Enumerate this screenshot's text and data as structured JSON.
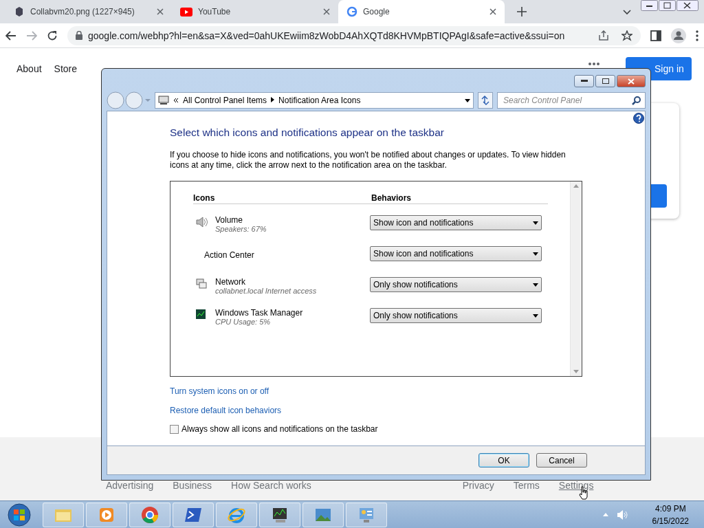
{
  "browser": {
    "tabs": [
      {
        "title": "Collabvm20.png (1227×945)",
        "kind": "image",
        "selected": false
      },
      {
        "title": "YouTube",
        "kind": "youtube",
        "selected": false
      },
      {
        "title": "Google",
        "kind": "google",
        "selected": true
      }
    ],
    "address": "google.com/webhp?hl=en&sa=X&ved=0ahUKEwiim8zWobD4AhXQTd8KHVMpBTIQPAgI&safe=active&ssui=on"
  },
  "page": {
    "left_links": [
      "About",
      "Store"
    ],
    "sign_in": "Sign in",
    "footer_left": [
      "Advertising",
      "Business",
      "How Search works"
    ],
    "footer_right": [
      "Privacy",
      "Terms",
      "Settings"
    ]
  },
  "dialog": {
    "breadcrumb": [
      "All Control Panel Items",
      "Notification Area Icons"
    ],
    "search_placeholder": "Search Control Panel",
    "heading": "Select which icons and notifications appear on the taskbar",
    "description": "If you choose to hide icons and notifications, you won't be notified about changes or updates. To view hidden icons at any time, click the arrow next to the notification area on the taskbar.",
    "columns": [
      "Icons",
      "Behaviors"
    ],
    "rows": [
      {
        "kind": "volume",
        "name": "Volume",
        "detail": "Speakers: 67%",
        "behavior": "Show icon and notifications"
      },
      {
        "kind": "none",
        "name": "Action Center",
        "behavior": "Show icon and notifications"
      },
      {
        "kind": "network",
        "name": "Network",
        "detail": "collabnet.local Internet access",
        "behavior": "Only show notifications"
      },
      {
        "kind": "taskmgr",
        "name": "Windows Task Manager",
        "detail": "CPU Usage: 5%",
        "behavior": "Only show notifications"
      }
    ],
    "links": [
      "Turn system icons on or off",
      "Restore default icon behaviors"
    ],
    "checkbox": {
      "label": "Always show all icons and notifications on the taskbar",
      "checked": false
    },
    "buttons": [
      {
        "label": "OK",
        "default": true
      },
      {
        "label": "Cancel",
        "default": false
      }
    ]
  },
  "taskbar": {
    "apps": [
      {
        "kind": "folder"
      },
      {
        "kind": "media"
      },
      {
        "kind": "chrome"
      },
      {
        "kind": "powershell"
      },
      {
        "kind": "ie"
      },
      {
        "kind": "monitor"
      },
      {
        "kind": "photo"
      },
      {
        "kind": "control"
      }
    ],
    "time": "4:09 PM",
    "date": "6/15/2022"
  }
}
